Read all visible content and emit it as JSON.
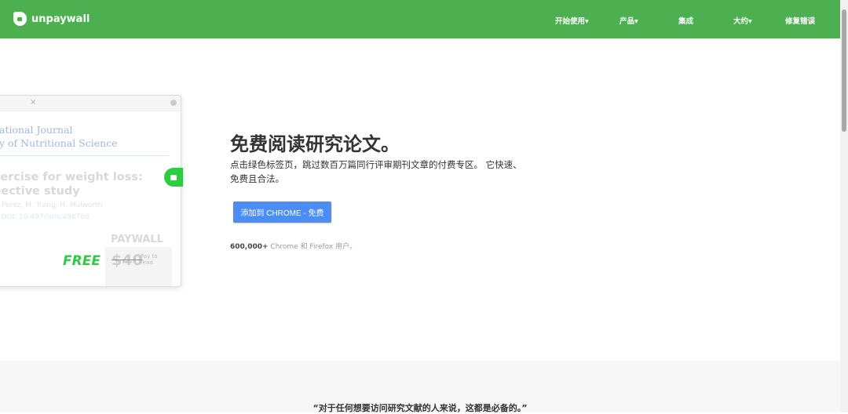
{
  "nav": {
    "brand": "unpaywall",
    "items": [
      "开始使用",
      "产品",
      "集成",
      "大约",
      "修复错误"
    ],
    "dropdown": [
      true,
      true,
      false,
      true,
      false
    ]
  },
  "illustration": {
    "journal_line1": "ational Journal",
    "journal_line2": "y of Nutritional Science",
    "title_line1": "xercise for weight loss:",
    "title_line2": "pective study",
    "authors": "). Perez, M. Trang, H. Mulworth",
    "doi": "7   DOI: 10.497/isns/498768",
    "paywall": "PAYWALL",
    "price": "$40",
    "pay_to_read": "Pay to read",
    "free": "FREE"
  },
  "hero": {
    "title": "免费阅读研究论文。",
    "description": "点击绿色标签页，跳过数百万篇同行评审期刊文章的付费专区。 它快速、免费且合法。",
    "button": "添加到 CHROME - 免费",
    "user_count": "600,000+",
    "user_text": " Chrome 和 Firefox 用户。"
  },
  "quote": "“对于任何想要访问研究文献的人来说，这都是必备的。”",
  "colors": {
    "brand_green": "#4caf50",
    "button_blue": "#4a8ef5"
  }
}
